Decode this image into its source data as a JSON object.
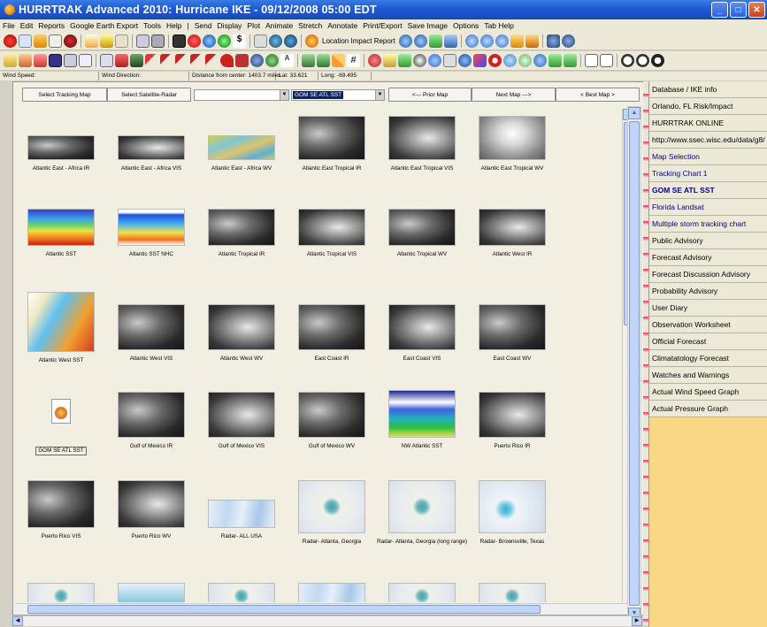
{
  "window": {
    "title": "HURRTRAK Advanced 2010: Hurricane IKE - 09/12/2008 05:00 EDT"
  },
  "menu": [
    "File",
    "Edit",
    "Reports",
    "Google Earth Export",
    "Tools",
    "Help",
    "|",
    "Send",
    "Display",
    "Plot",
    "Animate",
    "Stretch",
    "Annotate",
    "Print/Export",
    "Save Image",
    "Options",
    "Tab Help"
  ],
  "toolbar": {
    "location_report_label": "Location Impact Report"
  },
  "status": {
    "wind_speed": "Wind Speed:",
    "wind_direction": "Wind Direction:",
    "distance": "Distance from center: 1403.7 miles",
    "lat": "Lat: 33.621",
    "long": "Long: -69.495"
  },
  "buttons": {
    "select_tracking": "Select Tracking  Map",
    "select_satellite": "Select Satellite-Radar",
    "dropdown1": "",
    "dropdown2": "GOM SE ATL SST",
    "prior": "<--- Prior Map",
    "next": "Next Map --->",
    "best": "< Best Map >"
  },
  "gallery": [
    {
      "label": "Atlantic East - Africa IR"
    },
    {
      "label": "Atlantic East - Africa VIS"
    },
    {
      "label": "Atlantic East - Africa WV"
    },
    {
      "label": "Atlantic East Tropical IR"
    },
    {
      "label": "Atlantic East Tropical VIS"
    },
    {
      "label": "Atlantic East Tropical WV"
    },
    {
      "label": "Atlantic SST"
    },
    {
      "label": "Atlantic SST NHC"
    },
    {
      "label": "Atlantic Tropical IR"
    },
    {
      "label": "Atlantic Tropical VIS"
    },
    {
      "label": "Atlantic Tropical WV"
    },
    {
      "label": "Atlantic West IR"
    },
    {
      "label": "Atlantic West SST"
    },
    {
      "label": "Atlantic West VIS"
    },
    {
      "label": "Atlantic West WV"
    },
    {
      "label": "East Coast IR"
    },
    {
      "label": "East Coast VIS"
    },
    {
      "label": "East Coast WV"
    },
    {
      "label": "GOM SE ATL SST"
    },
    {
      "label": "Gulf of Mexico IR"
    },
    {
      "label": "Gulf of Mexico VIS"
    },
    {
      "label": "Gulf of Mexico WV"
    },
    {
      "label": "NW Atlantic SST"
    },
    {
      "label": "Puerto Rico IR"
    },
    {
      "label": "Puerto Rico VIS"
    },
    {
      "label": "Puerto Rico WV"
    },
    {
      "label": "Radar- ALL USA"
    },
    {
      "label": "Radar- Atlanta, Georgia"
    },
    {
      "label": "Radar- Atlanta, Georgia (long range)"
    },
    {
      "label": "Radar- Brownsville, Texas"
    }
  ],
  "sidebar": {
    "items": [
      {
        "label": "Database / IKE info"
      },
      {
        "label": "Orlando, FL Risk/Impact"
      },
      {
        "label": "HURRTRAK ONLINE"
      },
      {
        "label": "http://www.ssec.wisc.edu/data/g8/"
      },
      {
        "label": "Map Selection"
      },
      {
        "label": "Tracking Chart 1"
      },
      {
        "label": "GOM SE ATL SST"
      },
      {
        "label": "Florida Landsat"
      },
      {
        "label": "Multiple storm tracking chart"
      },
      {
        "label": "Public Advisory"
      },
      {
        "label": "Forecast Advisory"
      },
      {
        "label": "Forecast Discussion Advisory"
      },
      {
        "label": "Probability Advisory"
      },
      {
        "label": "User Diary"
      },
      {
        "label": "Observation Worksheet"
      },
      {
        "label": "Official Forecast"
      },
      {
        "label": "Climatatology Forecast"
      },
      {
        "label": "Watches and Warnings"
      },
      {
        "label": "Actual Wind Speed Graph"
      },
      {
        "label": "Actual Pressure Graph"
      }
    ]
  }
}
